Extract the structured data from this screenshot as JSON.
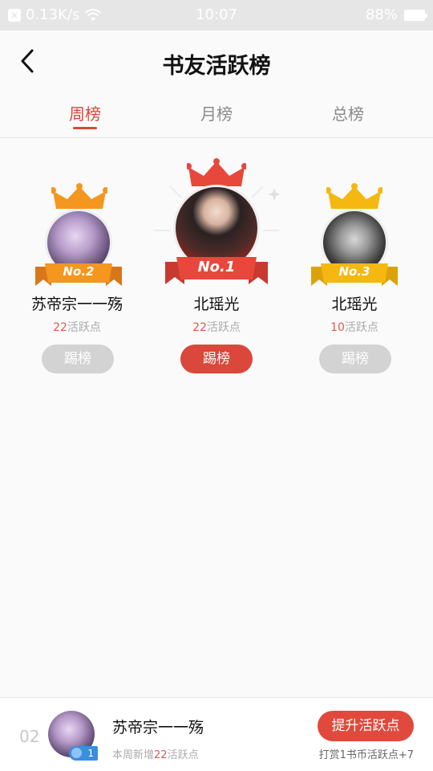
{
  "status_bar": {
    "speed": "0.13K/s",
    "time": "10:07",
    "battery": "88%"
  },
  "header": {
    "title": "书友活跃榜"
  },
  "tabs": [
    {
      "label": "周榜",
      "active": true
    },
    {
      "label": "月榜",
      "active": false
    },
    {
      "label": "总榜",
      "active": false
    }
  ],
  "podium": {
    "first": {
      "rank_label": "No.1",
      "name": "北瑶光",
      "points": "22",
      "points_unit": "活跃点",
      "button": "踢榜"
    },
    "second": {
      "rank_label": "No.2",
      "name": "苏帝宗一一殇",
      "points": "22",
      "points_unit": "活跃点",
      "button": "踢榜"
    },
    "third": {
      "rank_label": "No.3",
      "name": "北瑶光",
      "points": "10",
      "points_unit": "活跃点",
      "button": "踢榜"
    }
  },
  "my_entry": {
    "rank": "02",
    "badge_level": "1",
    "name": "苏帝宗一一殇",
    "sub_prefix": "本周新增",
    "sub_points": "22",
    "sub_suffix": "活跃点",
    "boost_button": "提升活跃点",
    "reward_note": "打赏1书币活跃点+7"
  },
  "colors": {
    "accent": "#d9483b",
    "gold": "#f5a623",
    "silver": "#f0921e",
    "kick_disabled": "#d3d3d3"
  }
}
